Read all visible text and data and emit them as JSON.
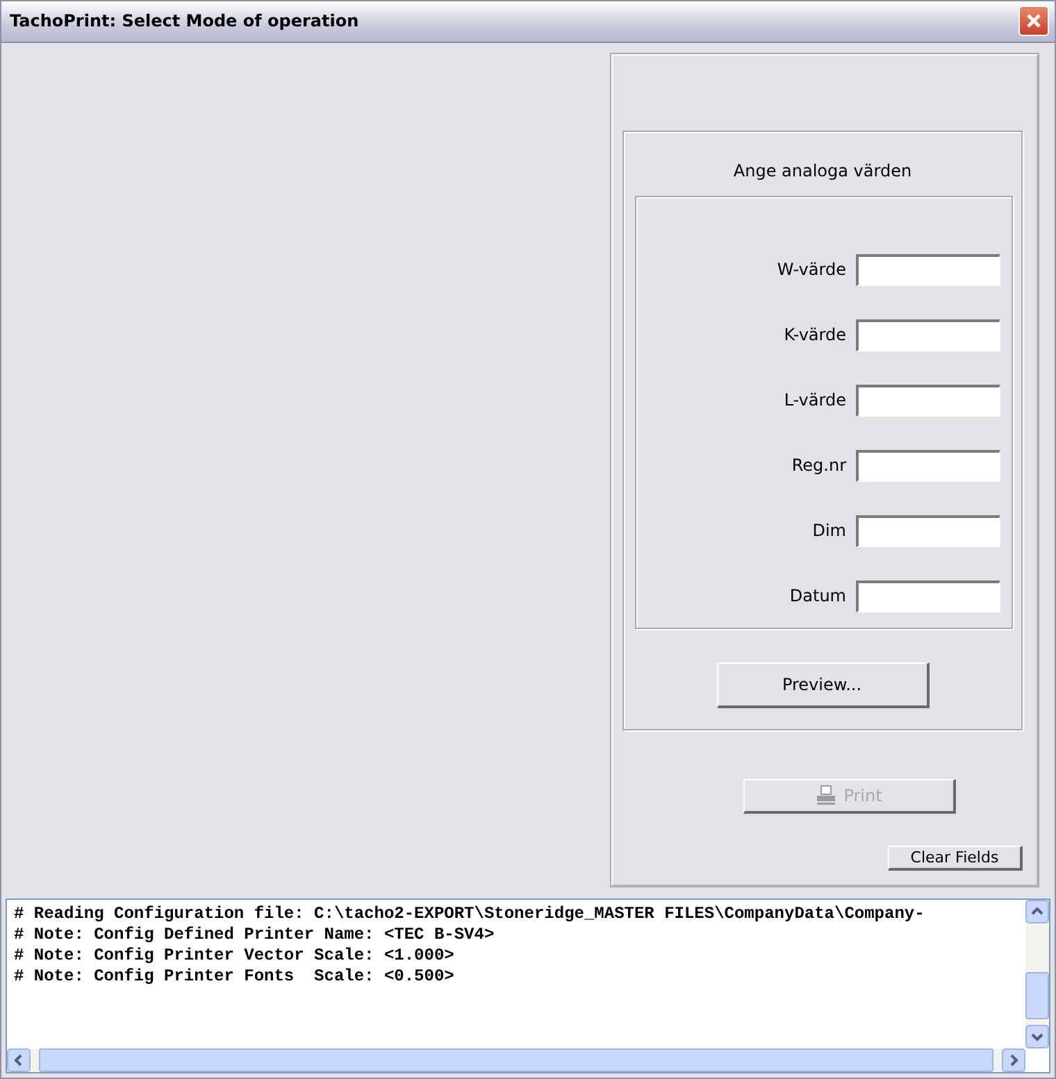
{
  "window": {
    "title": "TachoPrint: Select Mode of operation"
  },
  "panel": {
    "heading": "Ange analoga värden",
    "fields": [
      {
        "label": "W-värde"
      },
      {
        "label": "K-värde"
      },
      {
        "label": "L-värde"
      },
      {
        "label": "Reg.nr"
      },
      {
        "label": "Dim"
      },
      {
        "label": "Datum"
      }
    ],
    "preview_button": {
      "label": "Preview...",
      "disabled": false
    },
    "print_button": {
      "label": "Print",
      "disabled": true
    },
    "clear_button": {
      "label": "Clear Fields",
      "disabled": false
    }
  },
  "log": {
    "lines": [
      "# Reading Configuration file: C:\\tacho2-EXPORT\\Stoneridge_MASTER FILES\\CompanyData\\Company-",
      "# Note: Config Defined Printer Name: <TEC B-SV4>",
      "# Note: Config Printer Vector Scale: <1.000>",
      "# Note: Config Printer Fonts  Scale: <0.500>"
    ]
  }
}
